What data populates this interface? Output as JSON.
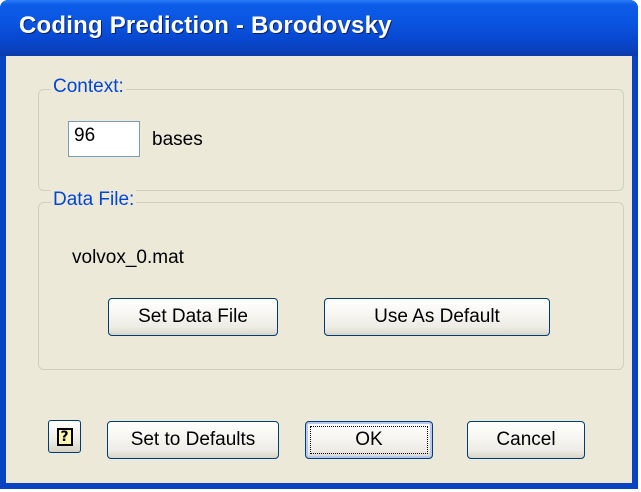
{
  "window": {
    "title": "Coding Prediction - Borodovsky"
  },
  "context": {
    "group_label": "Context:",
    "value": "96",
    "unit_label": "bases"
  },
  "data_file": {
    "group_label": "Data File:",
    "filename": "volvox_0.mat",
    "set_button": "Set Data File",
    "default_button": "Use As Default"
  },
  "footer": {
    "help_icon": "help-icon",
    "help_glyph": "?",
    "defaults_button": "Set to Defaults",
    "ok_button": "OK",
    "cancel_button": "Cancel"
  }
}
